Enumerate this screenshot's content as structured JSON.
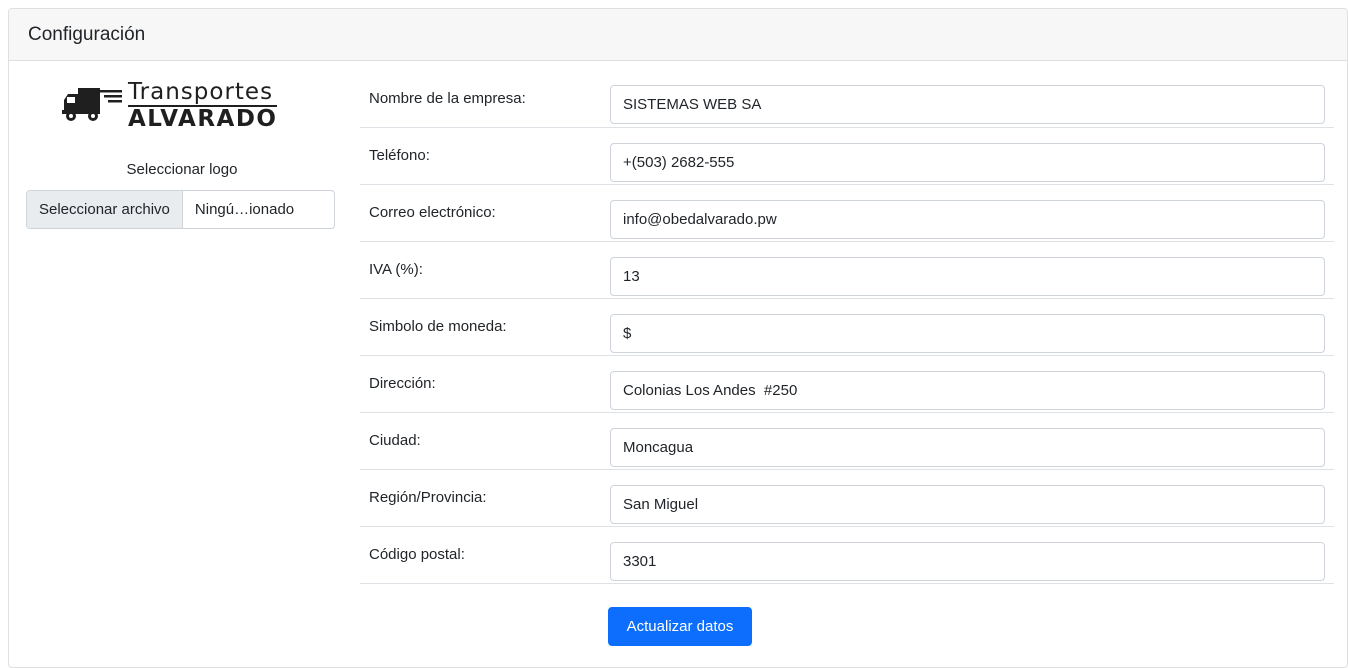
{
  "card": {
    "title": "Configuración"
  },
  "logo": {
    "line1": "Transportes",
    "line2": "ALVARADO",
    "icon": "truck-icon",
    "select_label": "Seleccionar logo",
    "file_button": "Seleccionar archivo",
    "file_status": "Ningú…ionado"
  },
  "fields": [
    {
      "label": "Nombre de la empresa:",
      "value": "SISTEMAS WEB SA"
    },
    {
      "label": "Teléfono:",
      "value": "+(503) 2682-555"
    },
    {
      "label": "Correo electrónico:",
      "value": "info@obedalvarado.pw"
    },
    {
      "label": "IVA (%):",
      "value": "13"
    },
    {
      "label": "Simbolo de moneda:",
      "value": "$"
    },
    {
      "label": "Dirección:",
      "value": "Colonias Los Andes  #250"
    },
    {
      "label": "Ciudad:",
      "value": "Moncagua"
    },
    {
      "label": "Región/Provincia:",
      "value": "San Miguel"
    },
    {
      "label": "Código postal:",
      "value": "3301"
    }
  ],
  "actions": {
    "submit_label": "Actualizar datos"
  },
  "colors": {
    "primary": "#0d6efd",
    "header_bg": "#f7f7f7",
    "border": "#dfdfdf"
  }
}
